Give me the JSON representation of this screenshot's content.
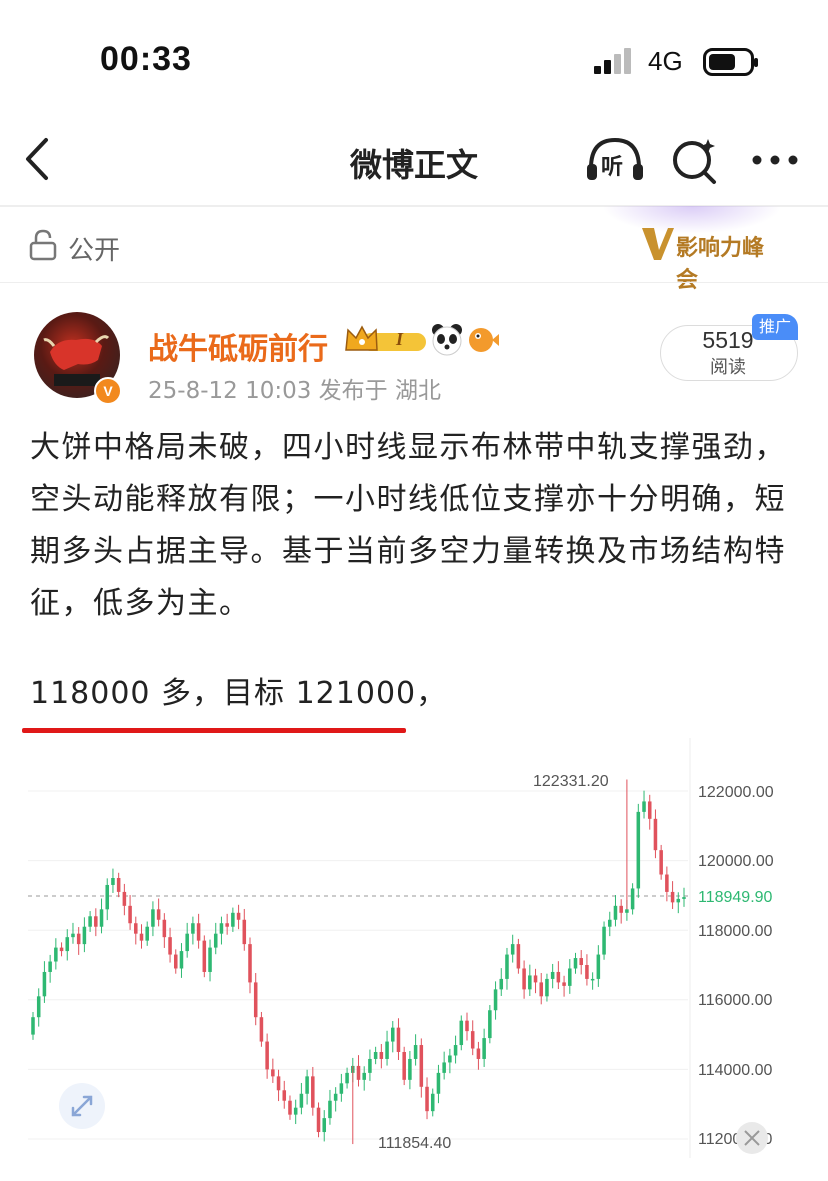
{
  "status_bar": {
    "time": "00:33",
    "network": "4G"
  },
  "nav": {
    "title": "微博正文",
    "listen_label": "听"
  },
  "visibility": {
    "label": "公开",
    "banner_text": "影响力峰会"
  },
  "post": {
    "author": "战牛砥砺前行",
    "level_badge": "I",
    "meta": "25-8-12 10:03  发布于 湖北",
    "read_count": "5519",
    "read_label": "阅读",
    "promo_badge": "推广",
    "body": "大饼中格局未破，四小时线显示布林带中轨支撑强劲，空头动能释放有限；一小时线低位支撑亦十分明确，短期多头占据主导。基于当前多空力量转换及市场结构特征，低多为主。",
    "target_line": "118000 多，目标 121000，"
  },
  "colors": {
    "up": "#2eb872",
    "down": "#e0525c",
    "accent": "#ea6a1a",
    "underline": "#e01818"
  },
  "chart_data": {
    "type": "candlestick",
    "ylim": [
      112000,
      123000
    ],
    "y_ticks": [
      "122000.00",
      "120000.00",
      "118000.00",
      "116000.00",
      "114000.00",
      "112000.00"
    ],
    "current_price": "118949.90",
    "high_label": "122331.20",
    "low_label": "111854.40",
    "closes": [
      115500,
      116100,
      116800,
      117100,
      117500,
      117400,
      117800,
      117900,
      117600,
      118100,
      118400,
      118100,
      118600,
      119300,
      119500,
      119100,
      118700,
      118200,
      117900,
      117700,
      118100,
      118600,
      118300,
      117800,
      117300,
      116900,
      117400,
      117900,
      118200,
      117700,
      116800,
      117500,
      117900,
      118200,
      118100,
      118500,
      118300,
      117600,
      116500,
      115500,
      114800,
      114000,
      113800,
      113400,
      113100,
      112700,
      112900,
      113300,
      113800,
      112900,
      112200,
      112600,
      113100,
      113300,
      113600,
      113900,
      114100,
      113700,
      113900,
      114300,
      114500,
      114300,
      114800,
      115200,
      114500,
      113700,
      114300,
      114700,
      113500,
      112800,
      113300,
      113900,
      114200,
      114400,
      114700,
      115400,
      115100,
      114600,
      114300,
      114900,
      115700,
      116300,
      116600,
      117300,
      117600,
      116900,
      116300,
      116700,
      116500,
      116100,
      116600,
      116800,
      116500,
      116400,
      116900,
      117200,
      117000,
      116600,
      116600,
      117300,
      118100,
      118300,
      118700,
      118500,
      118600,
      119200,
      121400,
      121700,
      121200,
      120300,
      119600,
      119100,
      118800,
      118900,
      118949.9
    ]
  }
}
